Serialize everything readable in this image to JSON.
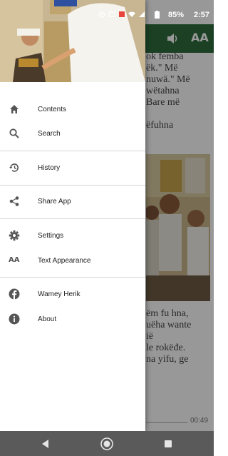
{
  "status_bar": {
    "battery": "85%",
    "clock": "2:57"
  },
  "toolbar": {
    "text_size_icon": "AA"
  },
  "reader": {
    "text_top": "ok femba\nëk.\" Më\nnuwä.\" Më\nwëtahna\nBare më\n\nëfuhna",
    "text_bottom": "ëm fu hna,\nuëha wante\nië\nle rokëđe.\nna yifu, ge",
    "audio_time": "00:49"
  },
  "drawer": {
    "items": [
      {
        "icon": "home-icon",
        "label": "Contents"
      },
      {
        "icon": "search-icon",
        "label": "Search"
      },
      {
        "icon": "history-icon",
        "label": "History"
      },
      {
        "icon": "share-icon",
        "label": "Share App"
      },
      {
        "icon": "gear-icon",
        "label": "Settings"
      },
      {
        "icon": "text-appearance-icon",
        "label": "Text Appearance",
        "glyph": "AA"
      },
      {
        "icon": "facebook-icon",
        "label": "Wamey Herik"
      },
      {
        "icon": "info-icon",
        "label": "About"
      }
    ]
  },
  "colors": {
    "toolbar": "#2e6b3c",
    "nav_bar": "#5a5a5a"
  }
}
